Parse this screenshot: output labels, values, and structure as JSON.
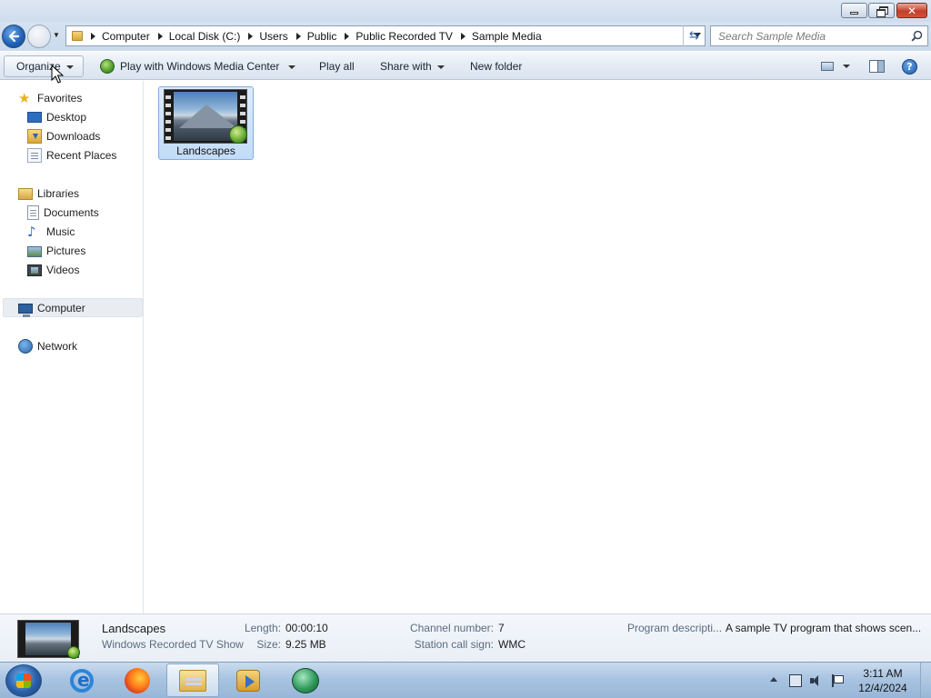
{
  "window": {
    "breadcrumb": [
      "Computer",
      "Local Disk (C:)",
      "Users",
      "Public",
      "Public Recorded TV",
      "Sample Media"
    ],
    "search_placeholder": "Search Sample Media"
  },
  "toolbar": {
    "organize": "Organize",
    "play_wmc": "Play with Windows Media Center",
    "play_all": "Play all",
    "share_with": "Share with",
    "new_folder": "New folder"
  },
  "nav": {
    "favorites": {
      "label": "Favorites",
      "items": [
        {
          "label": "Desktop",
          "icon": "desktop-icon"
        },
        {
          "label": "Downloads",
          "icon": "downloads-icon"
        },
        {
          "label": "Recent Places",
          "icon": "recent-places-icon"
        }
      ]
    },
    "libraries": {
      "label": "Libraries",
      "items": [
        {
          "label": "Documents",
          "icon": "documents-icon"
        },
        {
          "label": "Music",
          "icon": "music-icon"
        },
        {
          "label": "Pictures",
          "icon": "pictures-icon"
        },
        {
          "label": "Videos",
          "icon": "videos-icon"
        }
      ]
    },
    "computer": "Computer",
    "network": "Network",
    "selected": "Computer"
  },
  "files": [
    {
      "name": "Landscapes",
      "icon": "recorded-tv-thumbnail",
      "selected": true
    }
  ],
  "details": {
    "name": "Landscapes",
    "type": "Windows Recorded TV Show",
    "length_label": "Length:",
    "length": "00:00:10",
    "size_label": "Size:",
    "size": "9.25 MB",
    "channel_label": "Channel number:",
    "channel": "7",
    "station_label": "Station call sign:",
    "station": "WMC",
    "description_label": "Program descripti...",
    "description": "A sample TV program that shows scen..."
  },
  "taskbar": {
    "apps": [
      "internet-explorer",
      "firefox",
      "windows-explorer",
      "windows-media-player",
      "windows-media-center"
    ],
    "active_app": "windows-explorer",
    "time": "3:11 AM",
    "date": "12/4/2024"
  },
  "colors": {
    "selection_fill": "#cce4fb",
    "selection_border": "#84acdd",
    "titlebar": "#d6e3f1",
    "close_button": "#c4402b"
  }
}
